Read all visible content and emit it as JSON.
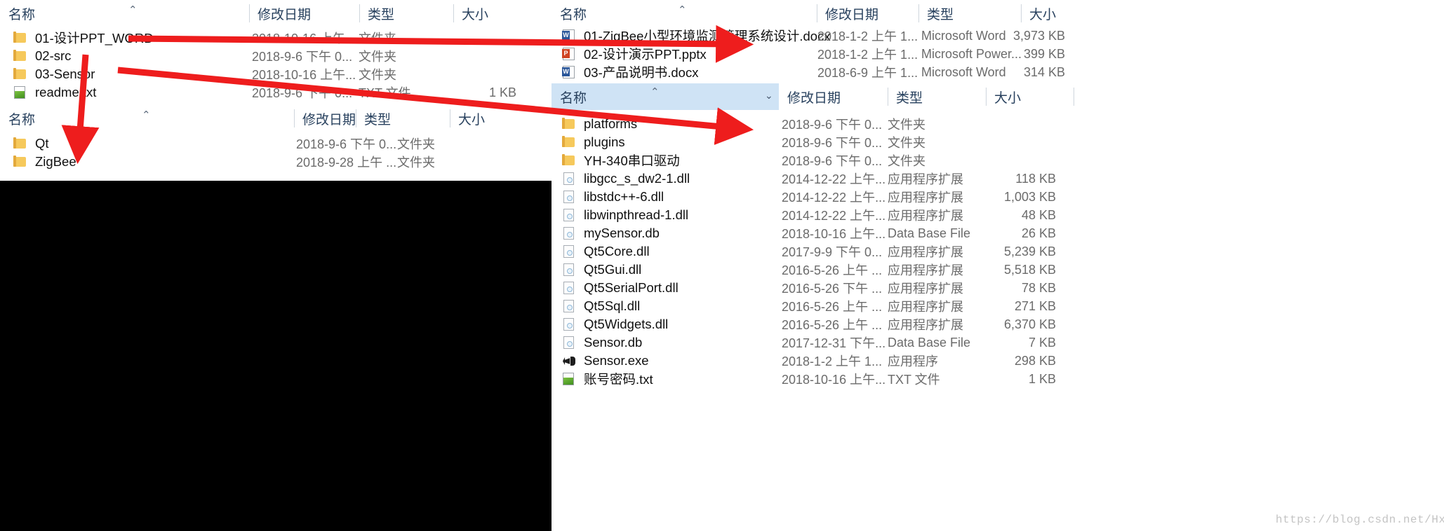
{
  "columns": {
    "name": "名称",
    "modified": "修改日期",
    "type": "类型",
    "size": "大小"
  },
  "left_panel": {
    "top_list": {
      "header": {
        "name": "名称",
        "modified": "修改日期",
        "type": "类型",
        "size": "大小",
        "sort_caret": "⌃"
      },
      "rows": [
        {
          "icon": "folder-icon",
          "name": "01-设计PPT_WORD",
          "modified": "2018-10-16 上午...",
          "type": "文件夹",
          "size": ""
        },
        {
          "icon": "folder-icon",
          "name": "02-src",
          "modified": "2018-9-6 下午 0...",
          "type": "文件夹",
          "size": ""
        },
        {
          "icon": "folder-icon",
          "name": "03-Sensor",
          "modified": "2018-10-16 上午...",
          "type": "文件夹",
          "size": ""
        },
        {
          "icon": "txt-file-icon",
          "name": "readme.txt",
          "modified": "2018-9-6 下午 0...",
          "type": "TXT 文件",
          "size": "1 KB"
        }
      ]
    },
    "bottom_list": {
      "header": {
        "name": "名称",
        "modified": "修改日期",
        "type": "类型",
        "size": "大小",
        "sort_caret": "⌃"
      },
      "rows": [
        {
          "icon": "folder-icon",
          "name": "Qt",
          "modified": "2018-9-6 下午 0...",
          "type": "文件夹",
          "size": ""
        },
        {
          "icon": "folder-icon",
          "name": "ZigBee",
          "modified": "2018-9-28 上午 ...",
          "type": "文件夹",
          "size": ""
        }
      ]
    }
  },
  "right_panel": {
    "top_list": {
      "header": {
        "name": "名称",
        "modified": "修改日期",
        "type": "类型",
        "size": "大小",
        "sort_caret": "⌃"
      },
      "rows": [
        {
          "icon": "word-file-icon",
          "name": "01-ZigBee小型环境监测管理系统设计.docx",
          "modified": "2018-1-2 上午 1...",
          "type": "Microsoft Word",
          "size": "3,973 KB"
        },
        {
          "icon": "powerpoint-file-icon",
          "name": "02-设计演示PPT.pptx",
          "modified": "2018-1-2 上午 1...",
          "type": "Microsoft Power...",
          "size": "399 KB"
        },
        {
          "icon": "word-file-icon",
          "name": "03-产品说明书.docx",
          "modified": "2018-6-9 上午 1...",
          "type": "Microsoft Word",
          "size": "314 KB"
        }
      ]
    },
    "bottom_list": {
      "header": {
        "name": "名称",
        "modified": "修改日期",
        "type": "类型",
        "size": "大小",
        "sort_caret": "⌃",
        "chevron": "⌄",
        "selected": true
      },
      "rows": [
        {
          "icon": "folder-icon",
          "name": "platforms",
          "modified": "2018-9-6 下午 0...",
          "type": "文件夹",
          "size": ""
        },
        {
          "icon": "folder-icon",
          "name": "plugins",
          "modified": "2018-9-6 下午 0...",
          "type": "文件夹",
          "size": ""
        },
        {
          "icon": "folder-icon",
          "name": "YH-340串口驱动",
          "modified": "2018-9-6 下午 0...",
          "type": "文件夹",
          "size": ""
        },
        {
          "icon": "dll-file-icon",
          "name": "libgcc_s_dw2-1.dll",
          "modified": "2014-12-22 上午...",
          "type": "应用程序扩展",
          "size": "118 KB"
        },
        {
          "icon": "dll-file-icon",
          "name": "libstdc++-6.dll",
          "modified": "2014-12-22 上午...",
          "type": "应用程序扩展",
          "size": "1,003 KB"
        },
        {
          "icon": "dll-file-icon",
          "name": "libwinpthread-1.dll",
          "modified": "2014-12-22 上午...",
          "type": "应用程序扩展",
          "size": "48 KB"
        },
        {
          "icon": "dll-file-icon",
          "name": "mySensor.db",
          "modified": "2018-10-16 上午...",
          "type": "Data Base File",
          "size": "26 KB"
        },
        {
          "icon": "dll-file-icon",
          "name": "Qt5Core.dll",
          "modified": "2017-9-9 下午 0...",
          "type": "应用程序扩展",
          "size": "5,239 KB"
        },
        {
          "icon": "dll-file-icon",
          "name": "Qt5Gui.dll",
          "modified": "2016-5-26 上午 ...",
          "type": "应用程序扩展",
          "size": "5,518 KB"
        },
        {
          "icon": "dll-file-icon",
          "name": "Qt5SerialPort.dll",
          "modified": "2016-5-26 下午 ...",
          "type": "应用程序扩展",
          "size": "78 KB"
        },
        {
          "icon": "dll-file-icon",
          "name": "Qt5Sql.dll",
          "modified": "2016-5-26 上午 ...",
          "type": "应用程序扩展",
          "size": "271 KB"
        },
        {
          "icon": "dll-file-icon",
          "name": "Qt5Widgets.dll",
          "modified": "2016-5-26 上午 ...",
          "type": "应用程序扩展",
          "size": "6,370 KB"
        },
        {
          "icon": "dll-file-icon",
          "name": "Sensor.db",
          "modified": "2017-12-31 下午...",
          "type": "Data Base File",
          "size": "7 KB"
        },
        {
          "icon": "exe-file-icon",
          "name": "Sensor.exe",
          "modified": "2018-1-2 上午 1...",
          "type": "应用程序",
          "size": "298 KB"
        },
        {
          "icon": "txt-file-icon",
          "name": "账号密码.txt",
          "modified": "2018-10-16 上午...",
          "type": "TXT 文件",
          "size": "1 KB"
        }
      ]
    }
  },
  "annotations": {
    "arrow_color": "#ee1d1d",
    "arrows": [
      {
        "name": "arrow-01-design-to-right-top-list"
      },
      {
        "name": "arrow-02-src-down-to-bottom-left-list"
      },
      {
        "name": "arrow-03-sensor-to-right-bottom-list"
      }
    ]
  },
  "watermark": {
    "text": "https://blog.csdn.net/Hxj_CSDN"
  }
}
